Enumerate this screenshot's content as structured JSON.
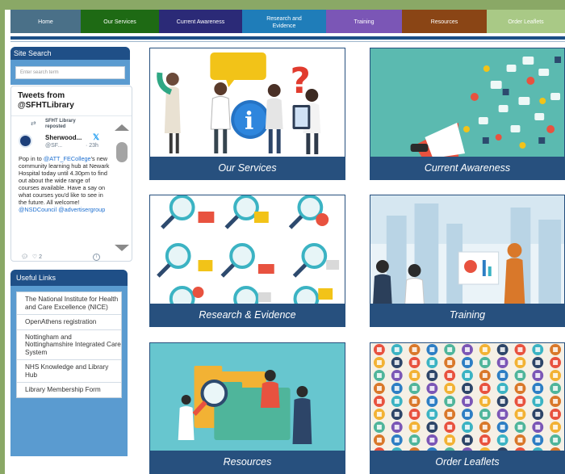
{
  "nav": {
    "items": [
      {
        "label": "Home",
        "color": "#4a7088"
      },
      {
        "label": "Our Services",
        "color": "#1e6a14"
      },
      {
        "label": "Current Awareness",
        "color": "#2b2a77"
      },
      {
        "label": "Research and Evidence",
        "color": "#1f7db9"
      },
      {
        "label": "Training",
        "color": "#7b56b6"
      },
      {
        "label": "Resources",
        "color": "#8a4515"
      },
      {
        "label": "Order Leaflets",
        "color": "#a9c986"
      }
    ]
  },
  "sidebar": {
    "search": {
      "title": "Site Search",
      "placeholder": "Enter search term"
    },
    "tweets": {
      "title": "Tweets from @SFHTLibrary",
      "reposted_by": "SFHT Library reposted",
      "author": "Sherwood...",
      "handle": "@SF...",
      "time": "· 23h",
      "text_1": "Pop in to ",
      "link_1": "@ATT_FECollege",
      "text_2": "'s new community learning hub at Newark Hospital today until 4.30pm to find out about the wide range of courses available. Have a say on what courses you'd like to see in the future. All welcome! ",
      "link_2": "@NSDCouncil",
      "link_3": "@advertisergroup",
      "likes": "2"
    },
    "useful_links": {
      "title": "Useful Links",
      "items": [
        "The National Institute for Health and Care Excellence (NICE)",
        "OpenAthens registration",
        "Nottingham and Nottinghamshire Integrated Care System",
        "NHS Knowledge and Library Hub",
        "Library Membership Form"
      ]
    }
  },
  "tiles": [
    {
      "caption": "Our Services",
      "icon": "people-info-illustration"
    },
    {
      "caption": "Current Awareness",
      "icon": "megaphone-illustration"
    },
    {
      "caption": "Research & Evidence",
      "icon": "magnifier-illustration"
    },
    {
      "caption": "Training",
      "icon": "presentation-illustration"
    },
    {
      "caption": "Resources",
      "icon": "folder-search-illustration"
    },
    {
      "caption": "Order Leaflets",
      "icon": "icon-grid-illustration"
    }
  ]
}
